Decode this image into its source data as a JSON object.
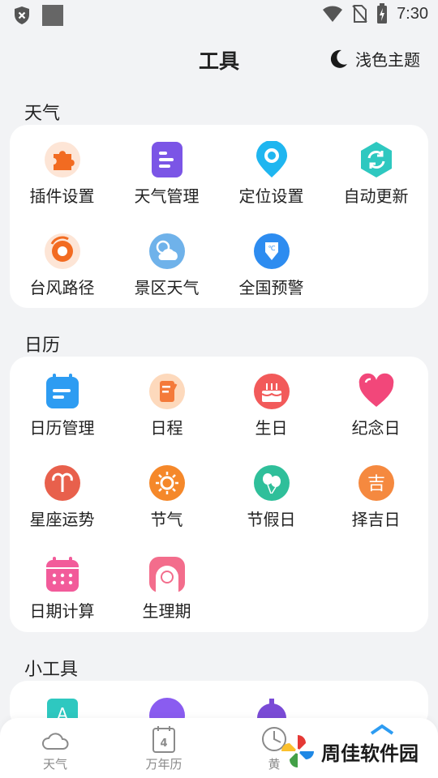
{
  "status_bar": {
    "time": "7:30"
  },
  "header": {
    "title": "工具",
    "theme_label": "浅色主题"
  },
  "sections": {
    "weather": {
      "title": "天气",
      "items": [
        {
          "label": "插件设置",
          "icon": "puzzle-icon"
        },
        {
          "label": "天气管理",
          "icon": "list-icon"
        },
        {
          "label": "定位设置",
          "icon": "location-pin-icon"
        },
        {
          "label": "自动更新",
          "icon": "refresh-icon"
        },
        {
          "label": "台风路径",
          "icon": "typhoon-icon"
        },
        {
          "label": "景区天气",
          "icon": "sun-cloud-icon"
        },
        {
          "label": "全国预警",
          "icon": "warning-shield-icon"
        }
      ]
    },
    "calendar": {
      "title": "日历",
      "items": [
        {
          "label": "日历管理",
          "icon": "calendar-list-icon"
        },
        {
          "label": "日程",
          "icon": "schedule-icon"
        },
        {
          "label": "生日",
          "icon": "birthday-cake-icon"
        },
        {
          "label": "纪念日",
          "icon": "heart-icon"
        },
        {
          "label": "星座运势",
          "icon": "aries-icon"
        },
        {
          "label": "节气",
          "icon": "solar-term-icon"
        },
        {
          "label": "节假日",
          "icon": "balloon-icon"
        },
        {
          "label": "择吉日",
          "icon": "auspicious-icon",
          "glyph": "吉"
        },
        {
          "label": "日期计算",
          "icon": "date-calc-icon"
        },
        {
          "label": "生理期",
          "icon": "period-icon"
        }
      ]
    },
    "tools": {
      "title": "小工具"
    }
  },
  "bottom_nav": {
    "items": [
      {
        "label": "天气",
        "icon": "cloud-icon"
      },
      {
        "label": "万年历",
        "icon": "calendar-icon",
        "day": "4"
      },
      {
        "label": "黄",
        "icon": "clock-icon"
      }
    ]
  },
  "watermark": {
    "text": "周佳软件园"
  },
  "colors": {
    "background": "#f2f3f5",
    "card": "#ffffff"
  }
}
